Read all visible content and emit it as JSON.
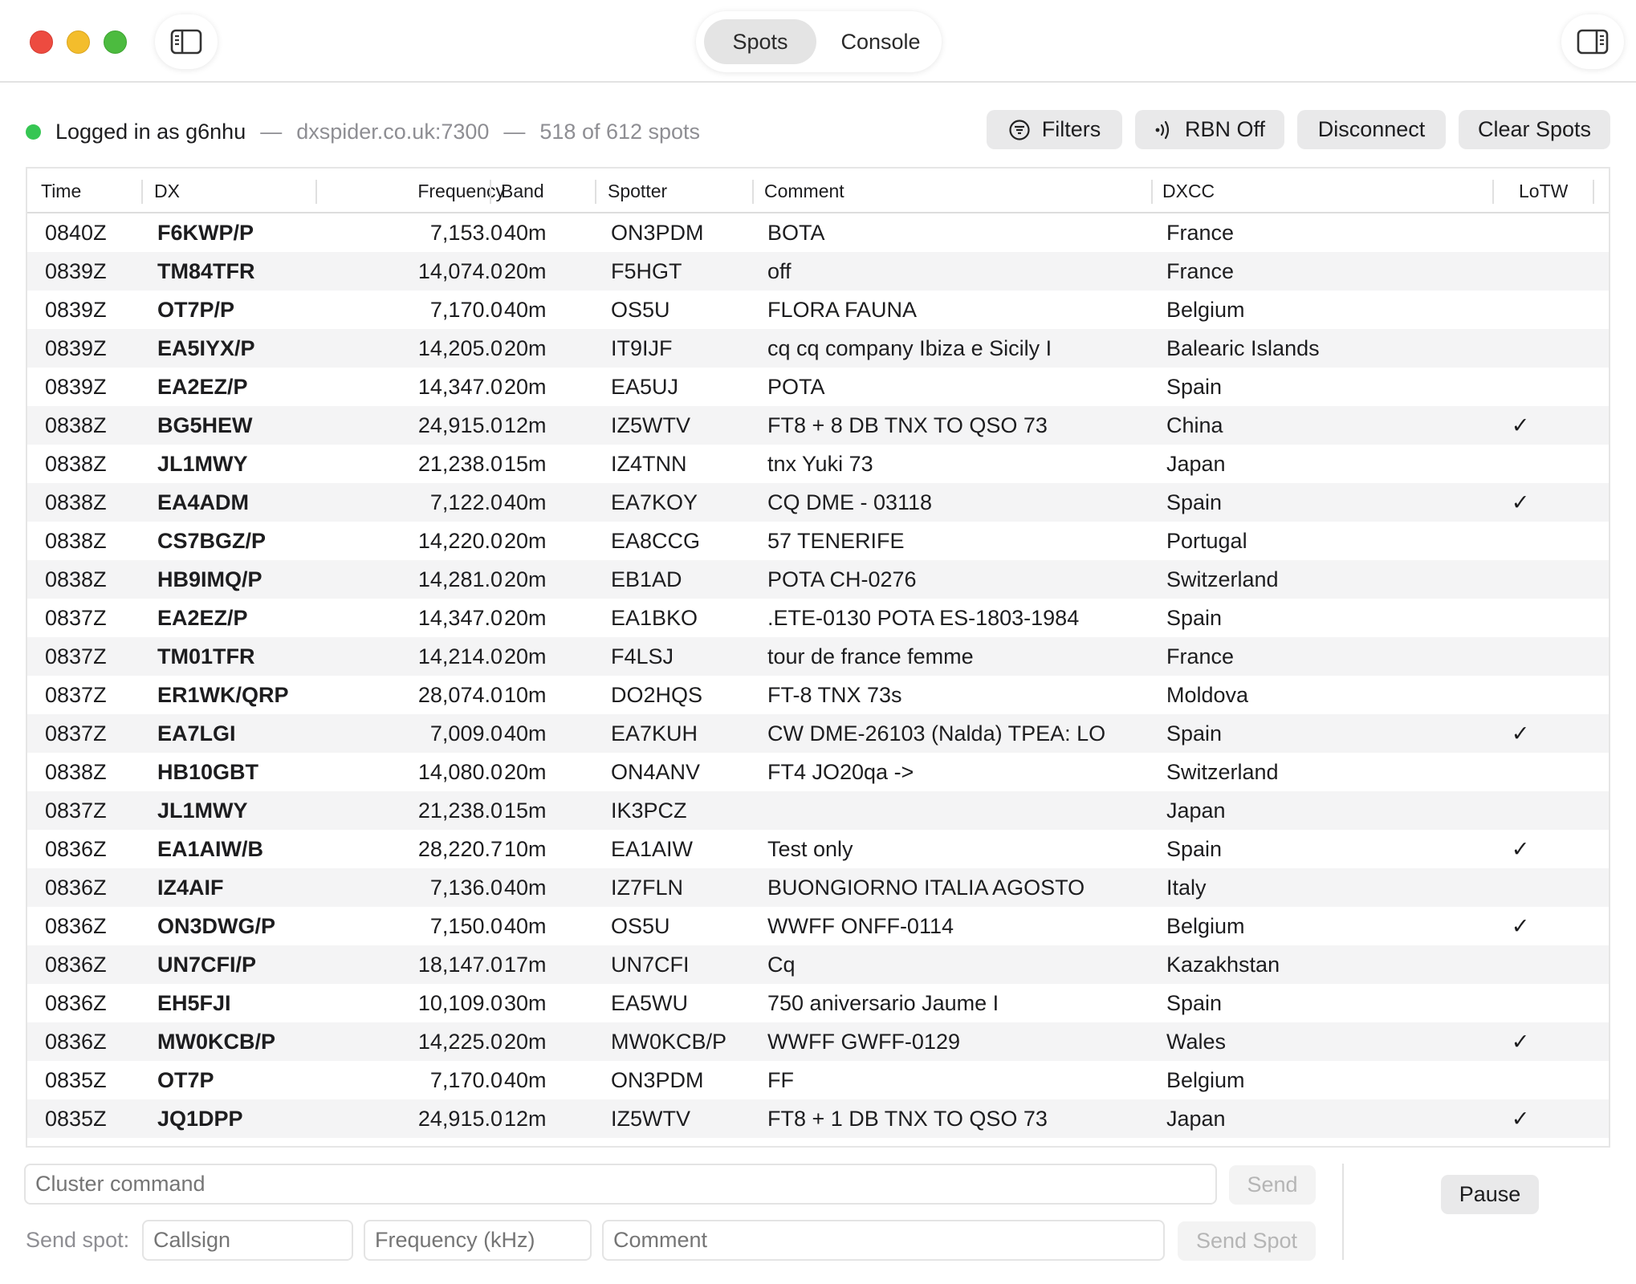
{
  "toolbar": {
    "tabs": [
      "Spots",
      "Console"
    ],
    "selected_tab": "Spots",
    "left_icon": "sidebar-left-icon",
    "right_icon": "sidebar-right-icon"
  },
  "status": {
    "login": "Logged in as g6nhu",
    "server": "dxspider.co.uk:7300",
    "count": "518 of 612 spots",
    "indicator_color": "#36c653",
    "separator": "—",
    "buttons": {
      "filters": "Filters",
      "rbn": "RBN Off",
      "disconnect": "Disconnect",
      "clear": "Clear Spots"
    }
  },
  "table": {
    "columns": [
      "Time",
      "DX",
      "Frequency",
      "Band",
      "Spotter",
      "Comment",
      "DXCC",
      "LoTW"
    ],
    "rows": [
      [
        "0840Z",
        "F6KWP/P",
        "7,153.0",
        "40m",
        "ON3PDM",
        "BOTA",
        "France",
        ""
      ],
      [
        "0839Z",
        "TM84TFR",
        "14,074.0",
        "20m",
        "F5HGT",
        "off",
        "France",
        ""
      ],
      [
        "0839Z",
        "OT7P/P",
        "7,170.0",
        "40m",
        "OS5U",
        "FLORA FAUNA",
        "Belgium",
        ""
      ],
      [
        "0839Z",
        "EA5IYX/P",
        "14,205.0",
        "20m",
        "IT9IJF",
        "cq cq company Ibiza e Sicily I",
        "Balearic Islands",
        ""
      ],
      [
        "0839Z",
        "EA2EZ/P",
        "14,347.0",
        "20m",
        "EA5UJ",
        "POTA",
        "Spain",
        ""
      ],
      [
        "0838Z",
        "BG5HEW",
        "24,915.0",
        "12m",
        "IZ5WTV",
        "FT8 + 8 DB TNX TO QSO 73",
        "China",
        "✓"
      ],
      [
        "0838Z",
        "JL1MWY",
        "21,238.0",
        "15m",
        "IZ4TNN",
        "tnx Yuki 73",
        "Japan",
        ""
      ],
      [
        "0838Z",
        "EA4ADM",
        "7,122.0",
        "40m",
        "EA7KOY",
        "CQ DME - 03118",
        "Spain",
        "✓"
      ],
      [
        "0838Z",
        "CS7BGZ/P",
        "14,220.0",
        "20m",
        "EA8CCG",
        "57 TENERIFE",
        "Portugal",
        ""
      ],
      [
        "0838Z",
        "HB9IMQ/P",
        "14,281.0",
        "20m",
        "EB1AD",
        "POTA CH-0276",
        "Switzerland",
        ""
      ],
      [
        "0837Z",
        "EA2EZ/P",
        "14,347.0",
        "20m",
        "EA1BKO",
        ".ETE-0130 POTA ES-1803-1984",
        "Spain",
        ""
      ],
      [
        "0837Z",
        "TM01TFR",
        "14,214.0",
        "20m",
        "F4LSJ",
        "tour de france femme",
        "France",
        ""
      ],
      [
        "0837Z",
        "ER1WK/QRP",
        "28,074.0",
        "10m",
        "DO2HQS",
        "FT-8 TNX 73s",
        "Moldova",
        ""
      ],
      [
        "0837Z",
        "EA7LGI",
        "7,009.0",
        "40m",
        "EA7KUH",
        "CW DME-26103 (Nalda) TPEA: LO",
        "Spain",
        "✓"
      ],
      [
        "0838Z",
        "HB10GBT",
        "14,080.0",
        "20m",
        "ON4ANV",
        "FT4 JO20qa ->",
        "Switzerland",
        ""
      ],
      [
        "0837Z",
        "JL1MWY",
        "21,238.0",
        "15m",
        "IK3PCZ",
        "",
        "Japan",
        ""
      ],
      [
        "0836Z",
        "EA1AIW/B",
        "28,220.7",
        "10m",
        "EA1AIW",
        "Test only",
        "Spain",
        "✓"
      ],
      [
        "0836Z",
        "IZ4AIF",
        "7,136.0",
        "40m",
        "IZ7FLN",
        "BUONGIORNO ITALIA AGOSTO",
        "Italy",
        ""
      ],
      [
        "0836Z",
        "ON3DWG/P",
        "7,150.0",
        "40m",
        "OS5U",
        "WWFF ONFF-0114",
        "Belgium",
        "✓"
      ],
      [
        "0836Z",
        "UN7CFI/P",
        "18,147.0",
        "17m",
        "UN7CFI",
        "Cq",
        "Kazakhstan",
        ""
      ],
      [
        "0836Z",
        "EH5FJI",
        "10,109.0",
        "30m",
        "EA5WU",
        "750 aniversario Jaume I",
        "Spain",
        ""
      ],
      [
        "0836Z",
        "MW0KCB/P",
        "14,225.0",
        "20m",
        "MW0KCB/P",
        "WWFF GWFF-0129",
        "Wales",
        "✓"
      ],
      [
        "0835Z",
        "OT7P",
        "7,170.0",
        "40m",
        "ON3PDM",
        "FF",
        "Belgium",
        ""
      ],
      [
        "0835Z",
        "JQ1DPP",
        "24,915.0",
        "12m",
        "IZ5WTV",
        "FT8 + 1 DB TNX TO QSO 73",
        "Japan",
        "✓"
      ]
    ]
  },
  "command": {
    "placeholder": "Cluster command",
    "send": "Send",
    "pause": "Pause"
  },
  "spot_form": {
    "label": "Send spot:",
    "callsign_placeholder": "Callsign",
    "frequency_placeholder": "Frequency (kHz)",
    "comment_placeholder": "Comment",
    "send": "Send Spot"
  }
}
